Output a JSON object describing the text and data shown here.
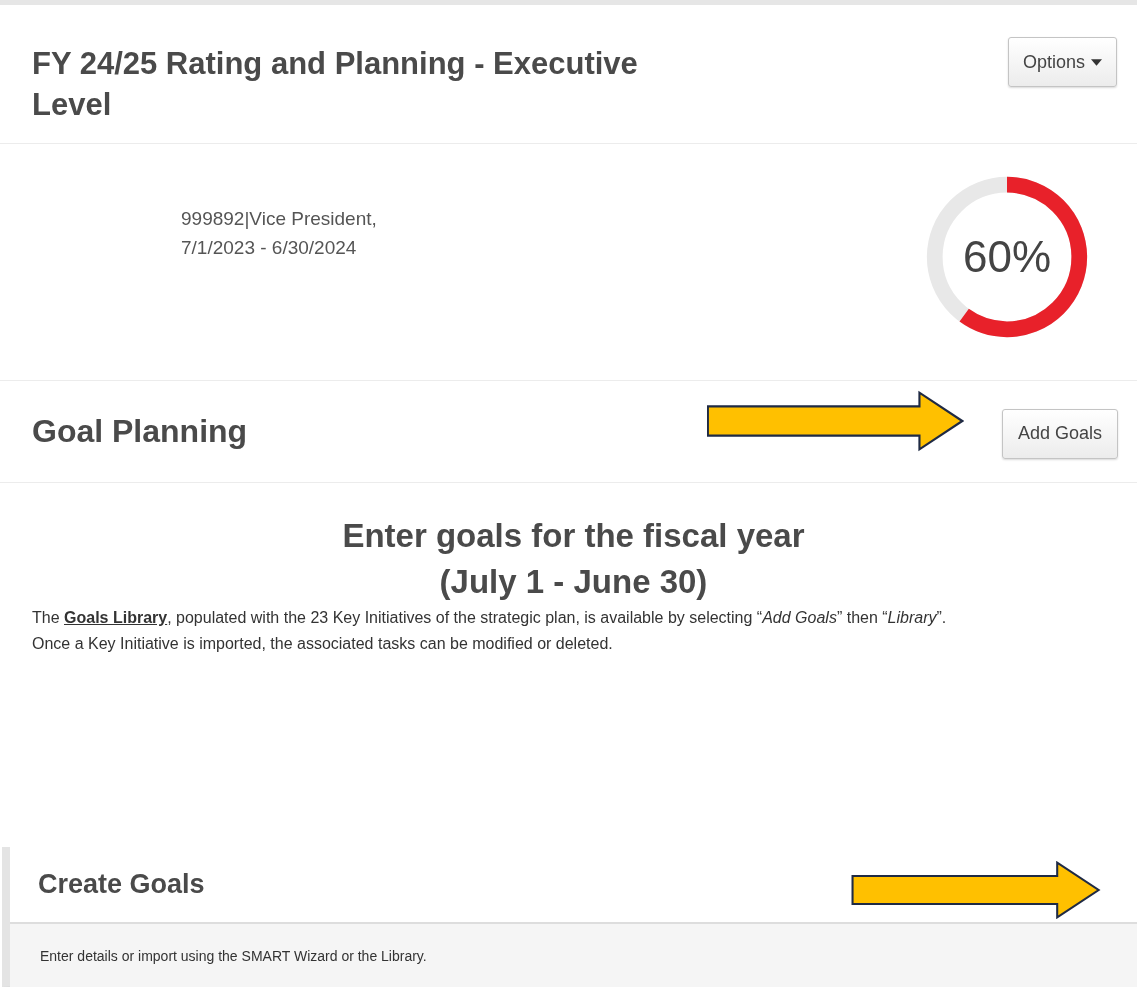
{
  "header": {
    "title": "FY 24/25 Rating and Planning - Executive Level",
    "options_button": "Options"
  },
  "profile": {
    "lines": [
      "999892|Vice President,",
      "7/1/2023 - 6/30/2024"
    ],
    "progress": {
      "level": 0.6,
      "label": "60%"
    }
  },
  "goal_planning": {
    "title": "Goal Planning",
    "add_button": "Add Goals",
    "arrow": true
  },
  "instructions": {
    "heading_lines": [
      "Enter goals for the fiscal year",
      "(July 1 - June 30)"
    ],
    "intro_before": "The ",
    "intro_link": "Goals Library",
    "intro_after": ", populated with the 23 Key Initiatives of the strategic plan, is available by selecting “*Add Goals*” then “*Library*”.",
    "intro_second": "Once a Key Initiative is imported, the associated tasks can be modified or deleted."
  },
  "create_goals": {
    "title": "Create Goals",
    "description": "Enter details or import using the SMART Wizard or the Library.",
    "arrow": true
  }
}
